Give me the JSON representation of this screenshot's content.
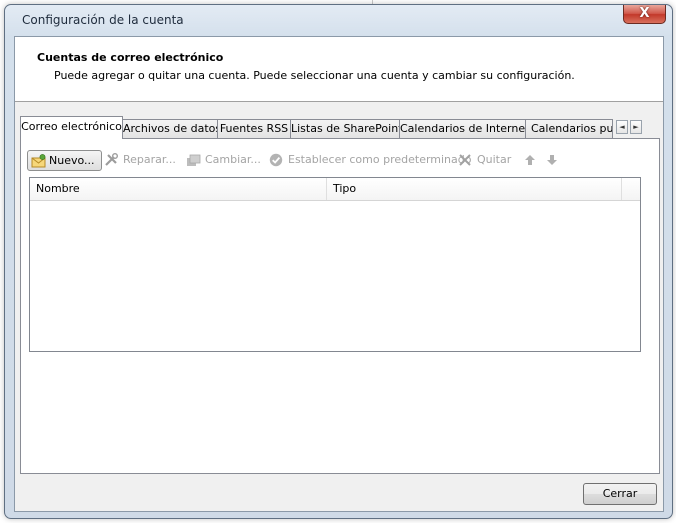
{
  "window": {
    "title": "Configuración de la cuenta",
    "close_glyph": "X"
  },
  "header": {
    "title": "Cuentas de correo electrónico",
    "description": "Puede agregar o quitar una cuenta. Puede seleccionar una cuenta y cambiar su configuración."
  },
  "tabs": [
    {
      "label": "Correo electrónico",
      "active": true
    },
    {
      "label": "Archivos de datos"
    },
    {
      "label": "Fuentes RSS"
    },
    {
      "label": "Listas de SharePoint"
    },
    {
      "label": "Calendarios de Internet"
    },
    {
      "label": "Calendarios publi"
    }
  ],
  "tab_scroll": {
    "left": "◄",
    "right": "►"
  },
  "toolbar": {
    "new_label": "Nuevo...",
    "repair_label": "Reparar...",
    "change_label": "Cambiar...",
    "default_label": "Establecer como predeterminado",
    "remove_label": "Quitar",
    "icons": [
      "new-mail-icon",
      "tools-icon",
      "change-icon",
      "check-circle-icon",
      "x-icon",
      "arrow-up-icon",
      "arrow-down-icon"
    ]
  },
  "list": {
    "columns": [
      "Nombre",
      "Tipo"
    ],
    "rows": []
  },
  "buttons": {
    "close_label": "Cerrar"
  },
  "colors": {
    "close_red": "#c2382a",
    "frame": "#d4e0ec"
  }
}
